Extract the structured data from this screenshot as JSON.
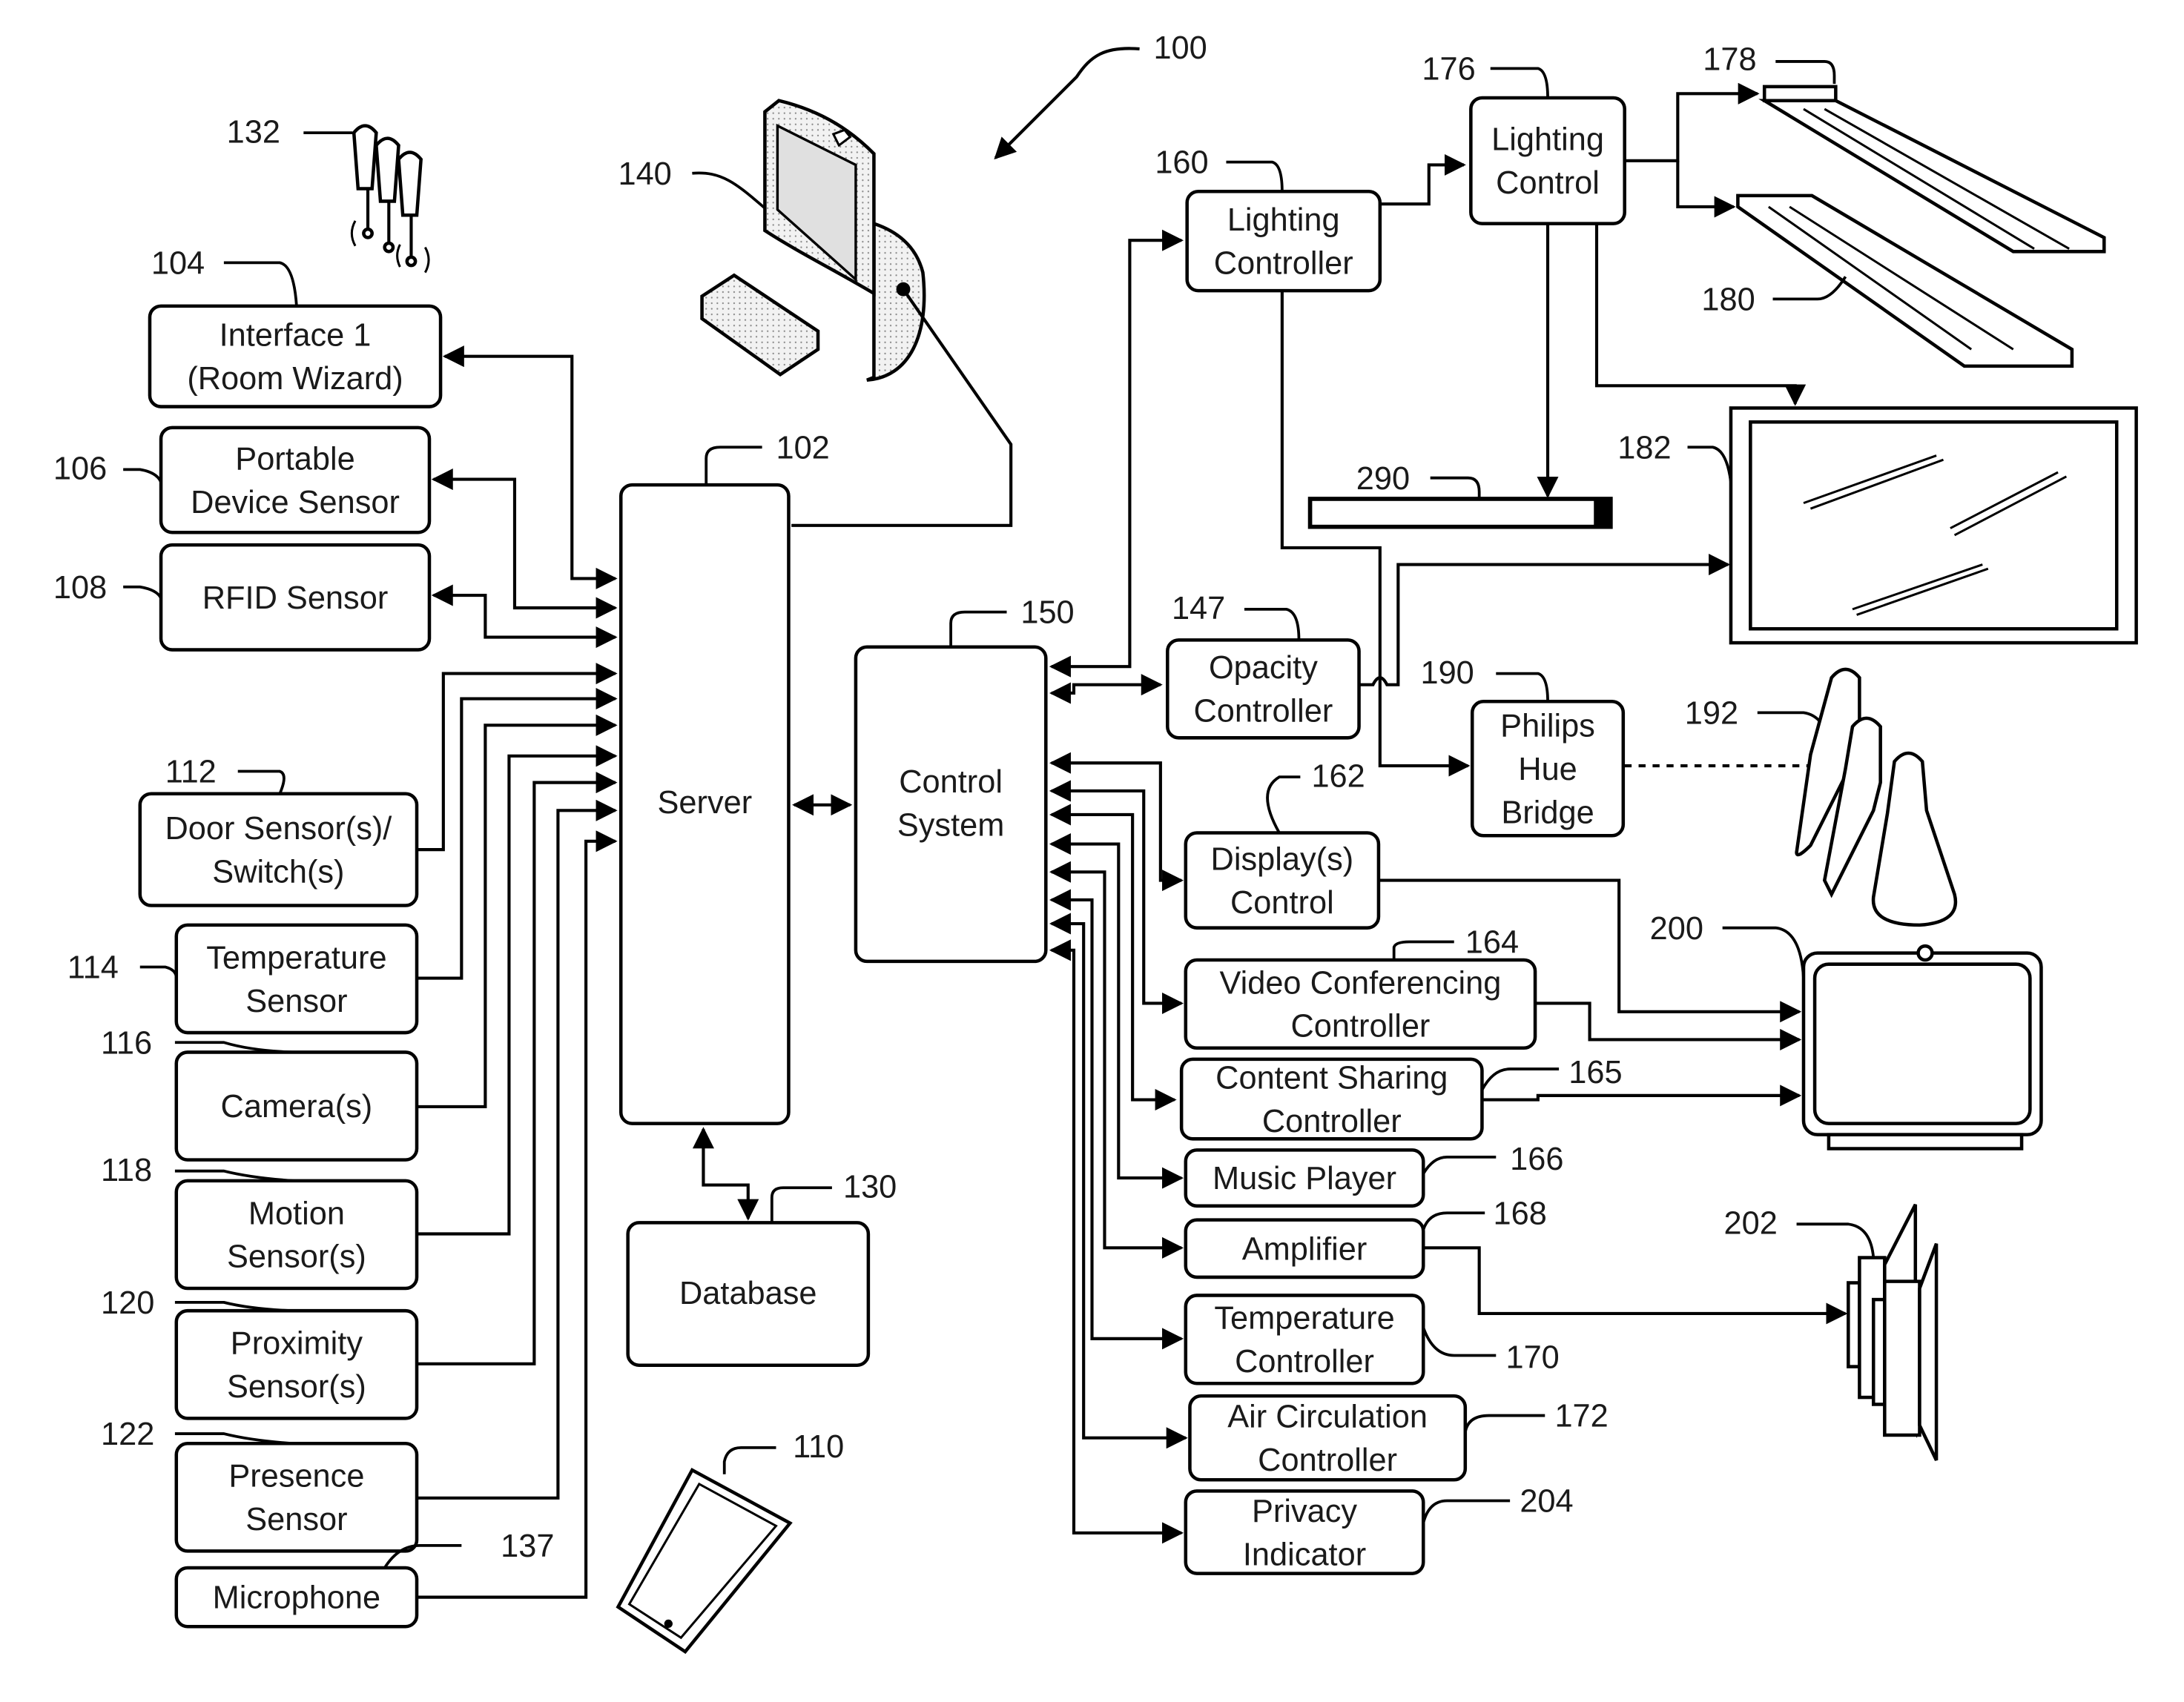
{
  "figure": {
    "system_ref": "100",
    "left_blocks": [
      {
        "id": "interface1",
        "ref": "104",
        "lines": [
          "Interface 1",
          "(Room Wizard)"
        ]
      },
      {
        "id": "portable",
        "ref": "106",
        "lines": [
          "Portable",
          "Device Sensor"
        ]
      },
      {
        "id": "rfid",
        "ref": "108",
        "lines": [
          "RFID Sensor"
        ]
      },
      {
        "id": "door",
        "ref": "112",
        "lines": [
          "Door Sensor(s)/",
          "Switch(s)"
        ]
      },
      {
        "id": "temp-sensor",
        "ref": "114",
        "lines": [
          "Temperature",
          "Sensor"
        ]
      },
      {
        "id": "camera",
        "ref": "116",
        "lines": [
          "Camera(s)"
        ]
      },
      {
        "id": "motion",
        "ref": "118",
        "lines": [
          "Motion",
          "Sensor(s)"
        ]
      },
      {
        "id": "proximity",
        "ref": "120",
        "lines": [
          "Proximity",
          "Sensor(s)"
        ]
      },
      {
        "id": "presence",
        "ref": "122",
        "lines": [
          "Presence",
          "Sensor"
        ]
      },
      {
        "id": "microphone",
        "ref": "137",
        "lines": [
          "Microphone"
        ]
      }
    ],
    "server": {
      "ref": "102",
      "label": "Server"
    },
    "database": {
      "ref": "130",
      "label": "Database"
    },
    "control_system": {
      "ref": "150",
      "lines": [
        "Control",
        "System"
      ]
    },
    "computer_ref": "140",
    "beacons_ref": "132",
    "mobile_ref": "110",
    "right_blocks": [
      {
        "id": "lighting-controller",
        "ref": "160",
        "lines": [
          "Lighting",
          "Controller"
        ]
      },
      {
        "id": "lighting-control",
        "ref": "176",
        "lines": [
          "Lighting",
          "Control"
        ]
      },
      {
        "id": "opacity",
        "ref": "147",
        "lines": [
          "Opacity",
          "Controller"
        ]
      },
      {
        "id": "hue-bridge",
        "ref": "190",
        "lines": [
          "Philips",
          "Hue",
          "Bridge"
        ]
      },
      {
        "id": "display-control",
        "ref": "162",
        "lines": [
          "Display(s)",
          "Control"
        ]
      },
      {
        "id": "video-conf",
        "ref": "164",
        "lines": [
          "Video Conferencing",
          "Controller"
        ]
      },
      {
        "id": "content-sharing",
        "ref": "165",
        "lines": [
          "Content Sharing",
          "Controller"
        ]
      },
      {
        "id": "music",
        "ref": "166",
        "lines": [
          "Music Player"
        ]
      },
      {
        "id": "amplifier",
        "ref": "168",
        "lines": [
          "Amplifier"
        ]
      },
      {
        "id": "temp-controller",
        "ref": "170",
        "lines": [
          "Temperature",
          "Controller"
        ]
      },
      {
        "id": "air",
        "ref": "172",
        "lines": [
          "Air Circulation",
          "Controller"
        ]
      },
      {
        "id": "privacy",
        "ref": "204",
        "lines": [
          "Privacy",
          "Indicator"
        ]
      }
    ],
    "devices": {
      "light_fixture_1_ref": "178",
      "light_fixture_2_ref": "180",
      "window_ref": "182",
      "shade_ref": "290",
      "bulbs_ref": "192",
      "display_ref": "200",
      "speakers_ref": "202"
    }
  }
}
